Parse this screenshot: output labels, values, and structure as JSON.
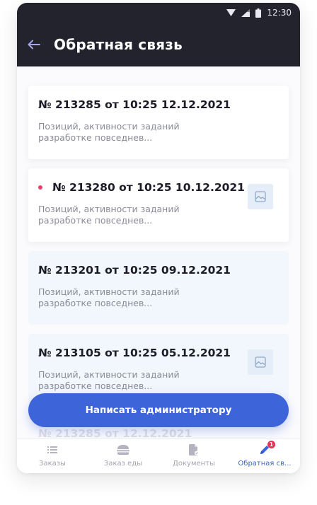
{
  "status_bar": {
    "time": "12:30"
  },
  "app_bar": {
    "title": "Обратная связь",
    "back_icon": "arrow-left-icon"
  },
  "colors": {
    "app_bar_bg": "#23232e",
    "accent": "#3d64d9",
    "unread_dot": "#e8416f",
    "card_highlight": "#f2f6fd"
  },
  "feedback_list": [
    {
      "title": "№ 213285 от 10:25 12.12.2021",
      "preview": "Позиций, активности заданий разработке повседнев...",
      "unread": false,
      "has_image": false,
      "style": "white"
    },
    {
      "title": "№ 213280 от 10:25 10.12.2021",
      "preview": "Позиций, активности заданий разработке повседнев...",
      "unread": true,
      "has_image": true,
      "style": "white"
    },
    {
      "title": "№ 213201 от 10:25 09.12.2021",
      "preview": "Позиций, активности заданий разработке повседнев...",
      "unread": false,
      "has_image": false,
      "style": "blue"
    },
    {
      "title": "№ 213105 от 10:25 05.12.2021",
      "preview": "Позиций, активности заданий разработке повседнев...",
      "unread": false,
      "has_image": true,
      "style": "blue"
    }
  ],
  "partial_item_title": "№ 213285 от 12.12.2021",
  "write_button": {
    "label": "Написать администратору"
  },
  "bottom_nav": [
    {
      "label": "Заказы",
      "icon": "list-icon",
      "active": false
    },
    {
      "label": "Заказ еды",
      "icon": "burger-icon",
      "active": false
    },
    {
      "label": "Документы",
      "icon": "document-icon",
      "active": false
    },
    {
      "label": "Обратная св...",
      "icon": "pen-icon",
      "active": true,
      "badge": "1"
    }
  ]
}
